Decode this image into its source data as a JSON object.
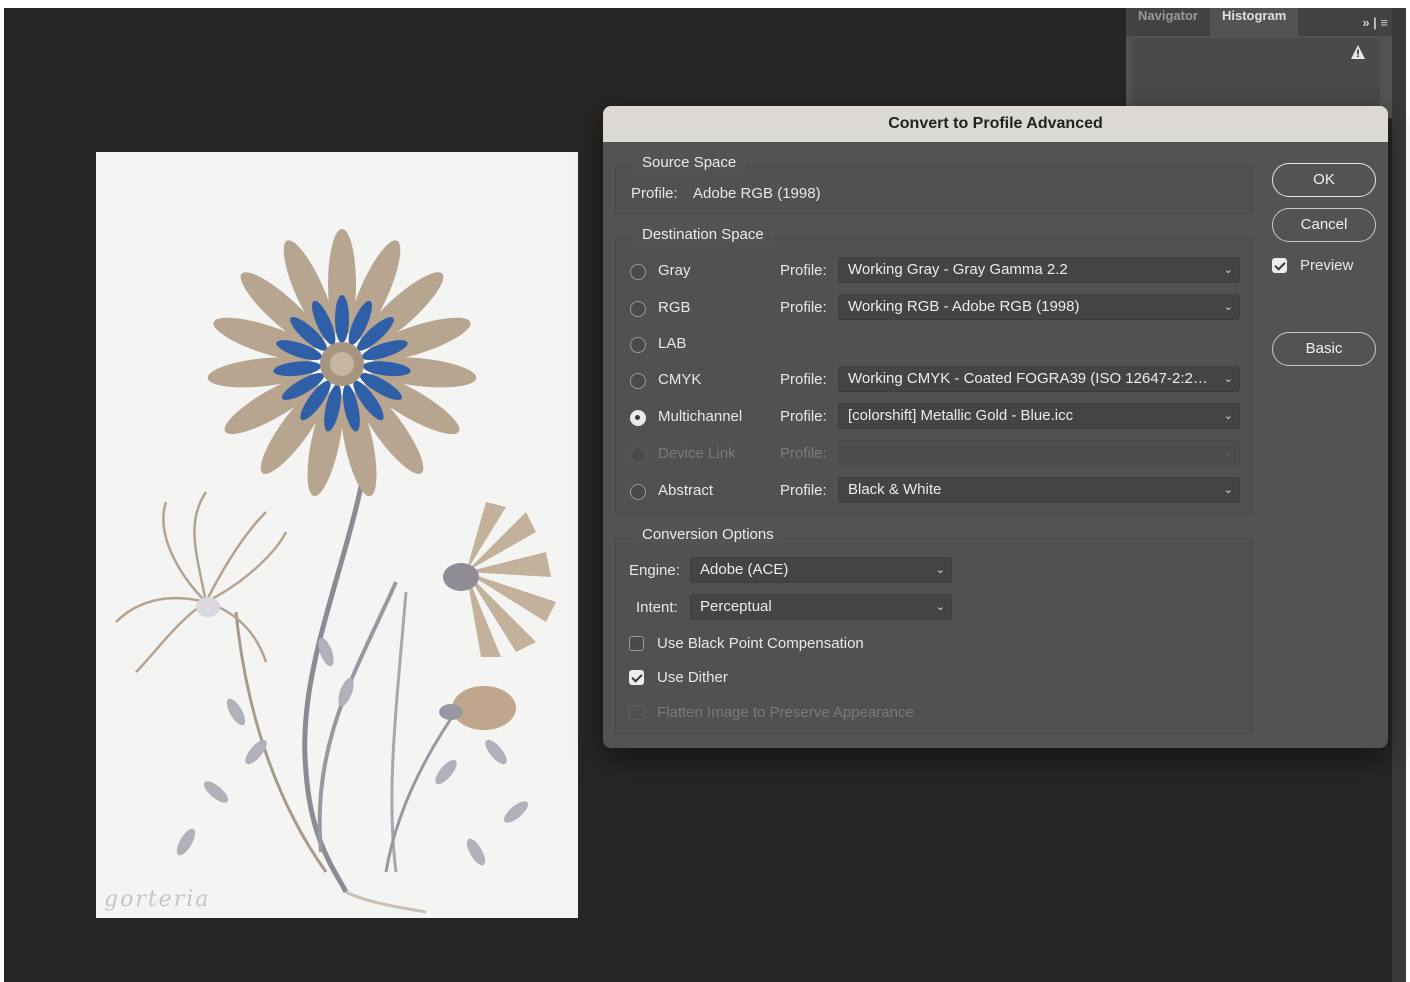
{
  "panel": {
    "tabs": [
      "Navigator",
      "Histogram"
    ],
    "menu_glyph": "» | ≡",
    "warning_icon": "warning-icon"
  },
  "artwork": {
    "signature": "gorteria"
  },
  "dialog": {
    "title": "Convert to Profile Advanced",
    "source": {
      "title": "Source Space",
      "profile_label": "Profile:",
      "profile_value": "Adobe RGB (1998)"
    },
    "destination": {
      "title": "Destination Space",
      "profile_label": "Profile:",
      "rows": [
        {
          "label": "Gray",
          "selected": false,
          "disabled": false,
          "profile": "Working Gray - Gray Gamma 2.2"
        },
        {
          "label": "RGB",
          "selected": false,
          "disabled": false,
          "profile": "Working RGB - Adobe RGB (1998)"
        },
        {
          "label": "LAB",
          "selected": false,
          "disabled": false,
          "profile": null
        },
        {
          "label": "CMYK",
          "selected": false,
          "disabled": false,
          "profile": "Working CMYK - Coated FOGRA39 (ISO 12647-2:2004)"
        },
        {
          "label": "Multichannel",
          "selected": true,
          "disabled": false,
          "profile": "[colorshift] Metallic Gold - Blue.icc"
        },
        {
          "label": "Device Link",
          "selected": false,
          "disabled": true,
          "profile": ""
        },
        {
          "label": "Abstract",
          "selected": false,
          "disabled": false,
          "profile": "Black & White"
        }
      ]
    },
    "conversion": {
      "title": "Conversion Options",
      "engine_label": "Engine:",
      "engine_value": "Adobe (ACE)",
      "intent_label": "Intent:",
      "intent_value": "Perceptual",
      "options": [
        {
          "label": "Use Black Point Compensation",
          "checked": false,
          "disabled": false
        },
        {
          "label": "Use Dither",
          "checked": true,
          "disabled": false
        },
        {
          "label": "Flatten Image to Preserve Appearance",
          "checked": false,
          "disabled": true
        }
      ]
    },
    "buttons": {
      "ok": "OK",
      "cancel": "Cancel",
      "basic": "Basic"
    },
    "preview": {
      "label": "Preview",
      "checked": true
    },
    "colors": {
      "titlebar": "#dcd9d4",
      "body": "#535353",
      "workspace": "#262626"
    }
  }
}
